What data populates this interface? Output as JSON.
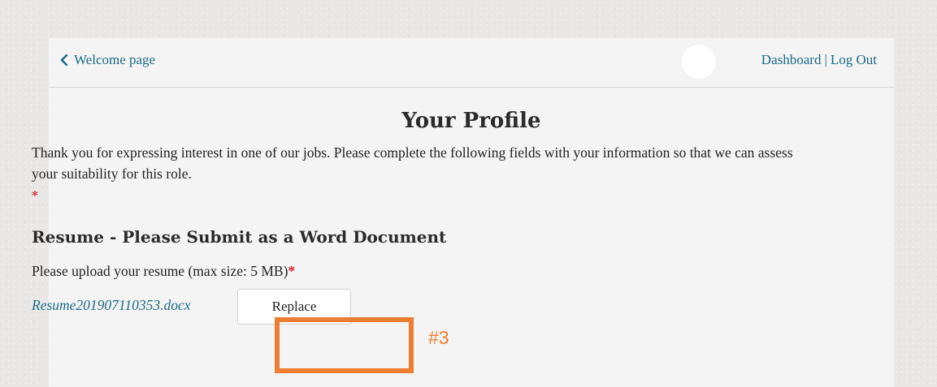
{
  "header": {
    "back_link_label": "Welcome page",
    "dashboard_label": "Dashboard",
    "separator": "|",
    "logout_label": "Log Out"
  },
  "main": {
    "title": "Your Profile",
    "intro_text": "Thank you for expressing interest in one of our jobs. Please complete the following fields with your information so that we can assess your suitability for this role.",
    "required_marker": "*"
  },
  "resume": {
    "heading": "Resume - Please Submit as a Word Document",
    "upload_label": "Please upload your resume (max size: 5 MB)",
    "required_marker": "*",
    "file_name": "Resume201907110353.docx",
    "replace_button_label": "Replace"
  },
  "annotation": {
    "label": "#3",
    "color": "#ed7d31"
  },
  "colors": {
    "link": "#1b6a86",
    "required": "#d0252b",
    "panel_background": "#f4f4f4"
  }
}
